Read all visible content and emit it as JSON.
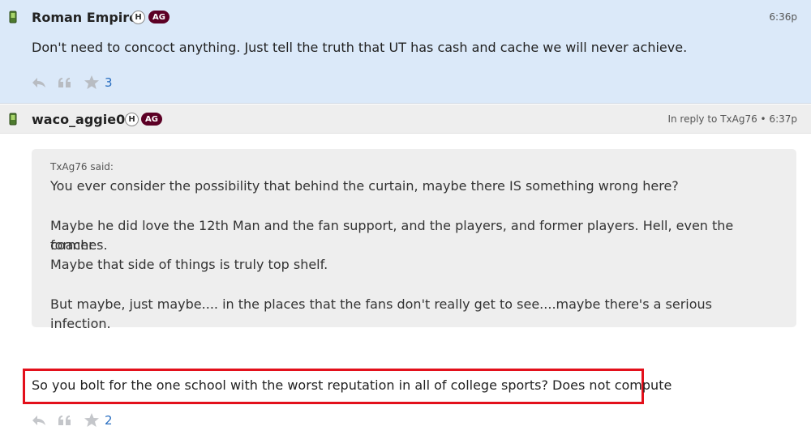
{
  "posts": [
    {
      "username": "Roman Empire",
      "badge_h": "H",
      "badge_ag": "AG",
      "time": "6:36p",
      "body": "Don't need to concoct anything. Just tell the truth that UT has cash and cache we will never achieve.",
      "star_count": "3"
    },
    {
      "username": "waco_aggie05",
      "badge_h": "H",
      "badge_ag": "AG",
      "time": "In reply to TxAg76 • 6:37p",
      "quote": {
        "author": "TxAg76 said:",
        "lines": [
          "You ever consider the possibility that behind the curtain, maybe there IS something wrong here?",
          "Maybe he did love the 12th Man and the fan support, and the players, and former players. Hell, even the former",
          "coaches.",
          "Maybe that side of things is truly top shelf.",
          "But maybe, just maybe.... in the places that the fans don't really get to see....maybe there's a serious infection."
        ]
      },
      "body": "So you bolt for the one school with the worst reputation in all of college sports? Does not compute",
      "star_count": "2"
    }
  ],
  "icons": {
    "device": "phone-icon",
    "reply": "reply-icon",
    "quote": "quote-icon",
    "star": "star-icon"
  },
  "colors": {
    "post1_bg": "#dbe9f9",
    "badge_ag": "#5c0025",
    "highlight": "#e3101b",
    "link": "#2a6fc1"
  }
}
